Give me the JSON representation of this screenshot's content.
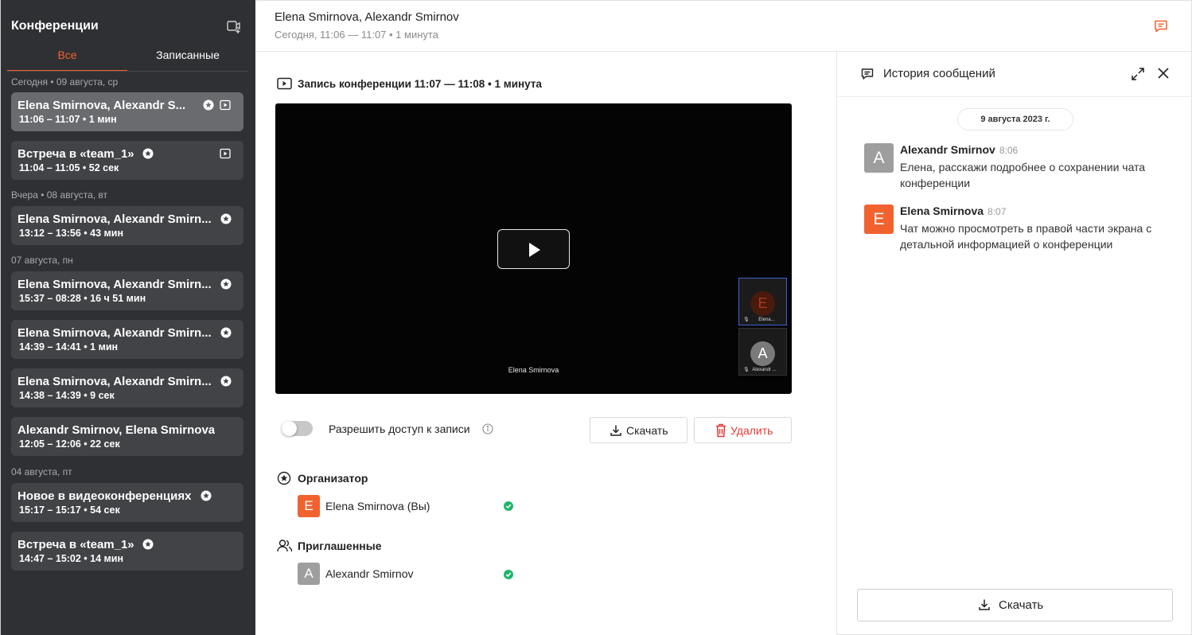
{
  "sidebar": {
    "title": "Конференции",
    "tabs": [
      {
        "label": "Все",
        "active": true
      },
      {
        "label": "Записанные",
        "active": false
      }
    ],
    "groups": [
      {
        "date": "Сегодня • 09 августа, ср"
      },
      {
        "date": "Вчера • 08 августа, вт"
      },
      {
        "date": "07 августа, пн"
      },
      {
        "date": "04 августа, пт"
      }
    ],
    "items": [
      {
        "title": "Elena Smirnova, Alexandr S...",
        "subtitle": "11:06 – 11:07 • 1 мин",
        "selected": true,
        "icons": [
          "star-circle-icon",
          "video-record-icon"
        ]
      },
      {
        "title": "Встреча в «team_1»",
        "subtitle": "11:04 – 11:05 • 52 сек",
        "icons": [
          "star-circle-icon",
          "video-record-icon"
        ]
      },
      {
        "title": "Elena Smirnova, Alexandr Smirn...",
        "subtitle": "13:12 – 13:56 • 43 мин",
        "icons": [
          "star-circle-icon"
        ]
      },
      {
        "title": "Elena Smirnova, Alexandr Smirn...",
        "subtitle": "15:37 – 08:28 • 16 ч 51 мин",
        "icons": [
          "star-circle-icon"
        ]
      },
      {
        "title": "Elena Smirnova, Alexandr Smirn...",
        "subtitle": "14:39 – 14:41 • 1 мин",
        "icons": [
          "star-circle-icon"
        ]
      },
      {
        "title": "Elena Smirnova, Alexandr Smirn...",
        "subtitle": "14:38 – 14:39 • 9 сек",
        "icons": [
          "star-circle-icon"
        ]
      },
      {
        "title": "Alexandr Smirnov, Elena Smirnova",
        "subtitle": "12:05 – 12:06 • 22 сек",
        "icons": []
      },
      {
        "title": "Новое в видеоконференциях",
        "subtitle": "15:17 – 15:17 • 54 сек",
        "icons": [
          "star-circle-icon"
        ]
      },
      {
        "title": "Встреча в «team_1»",
        "subtitle": "14:47 – 15:02 • 14 мин",
        "icons": [
          "star-circle-icon"
        ]
      }
    ]
  },
  "header": {
    "title": "Elena Smirnova, Alexandr Smirnov",
    "subtitle": "Сегодня, 11:06 — 11:07 • 1 минута"
  },
  "recording": {
    "title": "Запись конференции 11:07 — 11:08 • 1 минута",
    "video_speaker": "Elena Smirnova",
    "thumbs": [
      {
        "initial": "E",
        "label": "Elena..."
      },
      {
        "initial": "A",
        "label": "Alexandr ..."
      }
    ],
    "access_label": "Разрешить доступ к записи",
    "access_enabled": false,
    "download_label": "Скачать",
    "delete_label": "Удалить"
  },
  "organizer": {
    "title": "Организатор",
    "name": "Elena Smirnova (Вы)",
    "initial": "E"
  },
  "invited": {
    "title": "Приглашенные",
    "name": "Alexandr Smirnov",
    "initial": "A"
  },
  "chat": {
    "title": "История сообщений",
    "date": "9 августа 2023 г.",
    "messages": [
      {
        "initial": "A",
        "author": "Alexandr Smirnov",
        "time": "8:06",
        "text": "Елена, расскажи подробнее о сохранении чата конференции"
      },
      {
        "initial": "E",
        "author": "Elena Smirnova",
        "time": "8:07",
        "text": "Чат можно просмотреть в правой части экрана с детальной информацией о конференции"
      }
    ],
    "download_label": "Скачать"
  },
  "colors": {
    "accent": "#f2622e",
    "sidebar_bg": "#2f3033",
    "sidebar_item": "#424347",
    "sidebar_item_selected": "#6a6b6f",
    "avatar_a": "#9e9e9e",
    "avatar_e": "#f2622e",
    "success": "#1fb56a",
    "danger": "#e53935"
  }
}
